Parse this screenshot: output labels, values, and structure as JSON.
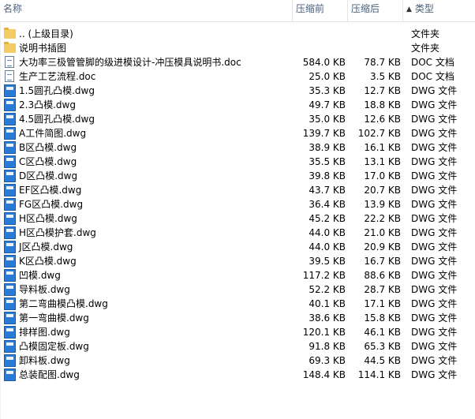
{
  "header": {
    "name": "名称",
    "compressed": "压缩前",
    "size": "压缩后",
    "type": "类型",
    "sort_arrow": "▲"
  },
  "rows": [
    {
      "name": ".. (上级目录)",
      "compressed": "",
      "size": "",
      "type": "文件夹",
      "icon": "folder-icon"
    },
    {
      "name": "说明书插图",
      "compressed": "",
      "size": "",
      "type": "文件夹",
      "icon": "folder-icon"
    },
    {
      "name": "大功率三极管管脚的级进模设计-冲压模具说明书.doc",
      "compressed": "584.0 KB",
      "size": "78.7 KB",
      "type": "DOC 文档",
      "icon": "doc-file-icon"
    },
    {
      "name": "生产工艺流程.doc",
      "compressed": "25.0 KB",
      "size": "3.5 KB",
      "type": "DOC 文档",
      "icon": "doc-file-icon"
    },
    {
      "name": "1.5圆孔凸模.dwg",
      "compressed": "35.3 KB",
      "size": "12.7 KB",
      "type": "DWG 文件",
      "icon": "dwg-file-icon"
    },
    {
      "name": "2.3凸模.dwg",
      "compressed": "49.7 KB",
      "size": "18.8 KB",
      "type": "DWG 文件",
      "icon": "dwg-file-icon"
    },
    {
      "name": "4.5圆孔凸模.dwg",
      "compressed": "35.0 KB",
      "size": "12.6 KB",
      "type": "DWG 文件",
      "icon": "dwg-file-icon"
    },
    {
      "name": "A工件简图.dwg",
      "compressed": "139.7 KB",
      "size": "102.7 KB",
      "type": "DWG 文件",
      "icon": "dwg-file-icon"
    },
    {
      "name": "B区凸模.dwg",
      "compressed": "38.9 KB",
      "size": "16.1 KB",
      "type": "DWG 文件",
      "icon": "dwg-file-icon"
    },
    {
      "name": "C区凸模.dwg",
      "compressed": "35.5 KB",
      "size": "13.1 KB",
      "type": "DWG 文件",
      "icon": "dwg-file-icon"
    },
    {
      "name": "D区凸模.dwg",
      "compressed": "39.8 KB",
      "size": "17.0 KB",
      "type": "DWG 文件",
      "icon": "dwg-file-icon"
    },
    {
      "name": "EF区凸模.dwg",
      "compressed": "43.7 KB",
      "size": "20.7 KB",
      "type": "DWG 文件",
      "icon": "dwg-file-icon"
    },
    {
      "name": "FG区凸模.dwg",
      "compressed": "36.4 KB",
      "size": "13.9 KB",
      "type": "DWG 文件",
      "icon": "dwg-file-icon"
    },
    {
      "name": "H区凸模.dwg",
      "compressed": "45.2 KB",
      "size": "22.2 KB",
      "type": "DWG 文件",
      "icon": "dwg-file-icon"
    },
    {
      "name": "H区凸模护套.dwg",
      "compressed": "44.0 KB",
      "size": "21.0 KB",
      "type": "DWG 文件",
      "icon": "dwg-file-icon"
    },
    {
      "name": "J区凸模.dwg",
      "compressed": "44.0 KB",
      "size": "20.9 KB",
      "type": "DWG 文件",
      "icon": "dwg-file-icon"
    },
    {
      "name": "K区凸模.dwg",
      "compressed": "39.5 KB",
      "size": "16.7 KB",
      "type": "DWG 文件",
      "icon": "dwg-file-icon"
    },
    {
      "name": "凹模.dwg",
      "compressed": "117.2 KB",
      "size": "88.6 KB",
      "type": "DWG 文件",
      "icon": "dwg-file-icon"
    },
    {
      "name": "导料板.dwg",
      "compressed": "52.2 KB",
      "size": "28.7 KB",
      "type": "DWG 文件",
      "icon": "dwg-file-icon"
    },
    {
      "name": "第二弯曲模凸模.dwg",
      "compressed": "40.1 KB",
      "size": "17.1 KB",
      "type": "DWG 文件",
      "icon": "dwg-file-icon"
    },
    {
      "name": "第一弯曲模.dwg",
      "compressed": "38.6 KB",
      "size": "15.8 KB",
      "type": "DWG 文件",
      "icon": "dwg-file-icon"
    },
    {
      "name": "排样图.dwg",
      "compressed": "120.1 KB",
      "size": "46.1 KB",
      "type": "DWG 文件",
      "icon": "dwg-file-icon"
    },
    {
      "name": "凸模固定板.dwg",
      "compressed": "91.8 KB",
      "size": "65.3 KB",
      "type": "DWG 文件",
      "icon": "dwg-file-icon"
    },
    {
      "name": "卸料板.dwg",
      "compressed": "69.3 KB",
      "size": "44.5 KB",
      "type": "DWG 文件",
      "icon": "dwg-file-icon"
    },
    {
      "name": "总装配图.dwg",
      "compressed": "148.4 KB",
      "size": "114.1 KB",
      "type": "DWG 文件",
      "icon": "dwg-file-icon"
    }
  ]
}
